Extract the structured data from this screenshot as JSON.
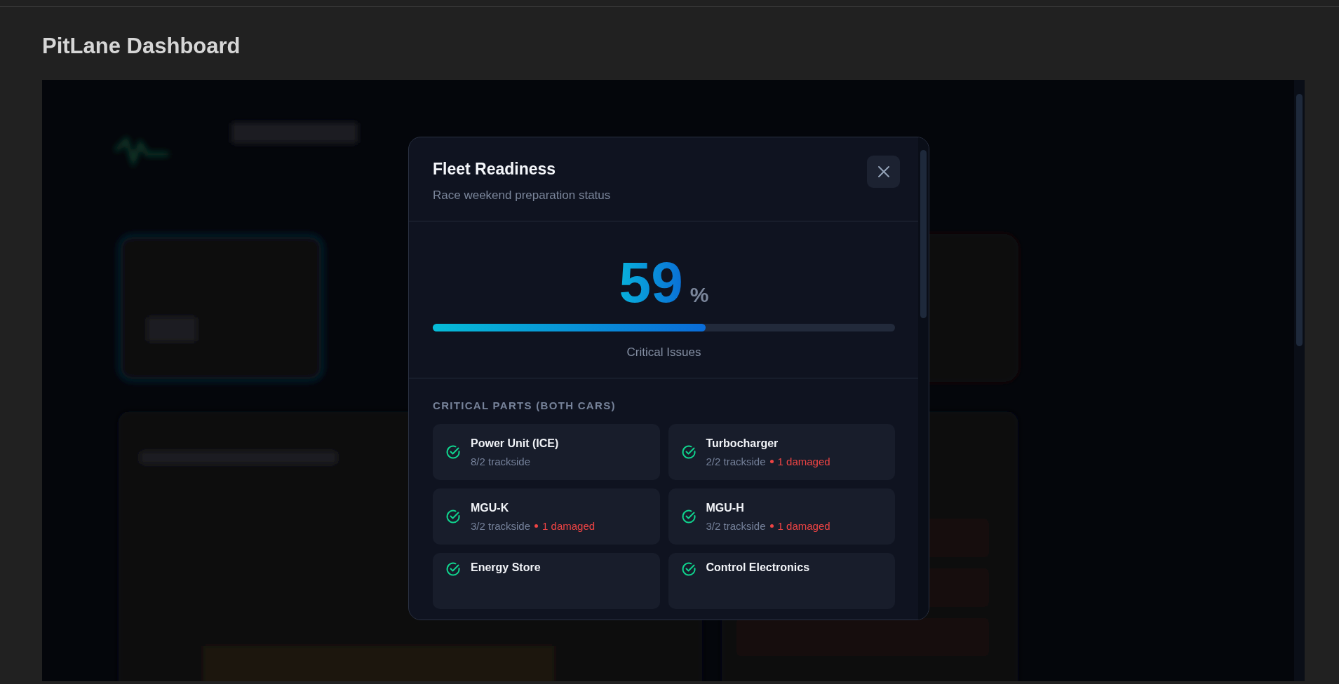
{
  "page": {
    "title": "PitLane Dashboard"
  },
  "modal": {
    "title": "Fleet Readiness",
    "subtitle": "Race weekend preparation status",
    "readiness": {
      "value": "59",
      "unit": "%",
      "level": 0.59,
      "caption": "Critical Issues"
    },
    "section_title": "CRITICAL PARTS (BOTH CARS)",
    "parts": [
      {
        "name": "Power Unit (ICE)",
        "trackside": "8/2 trackside"
      },
      {
        "name": "Turbocharger",
        "trackside": "2/2 trackside",
        "damaged": "1 damaged"
      },
      {
        "name": "MGU-K",
        "trackside": "3/2 trackside",
        "damaged": "1 damaged"
      },
      {
        "name": "MGU-H",
        "trackside": "3/2 trackside",
        "damaged": "1 damaged"
      },
      {
        "name": "Energy Store"
      },
      {
        "name": "Control Electronics"
      }
    ]
  }
}
